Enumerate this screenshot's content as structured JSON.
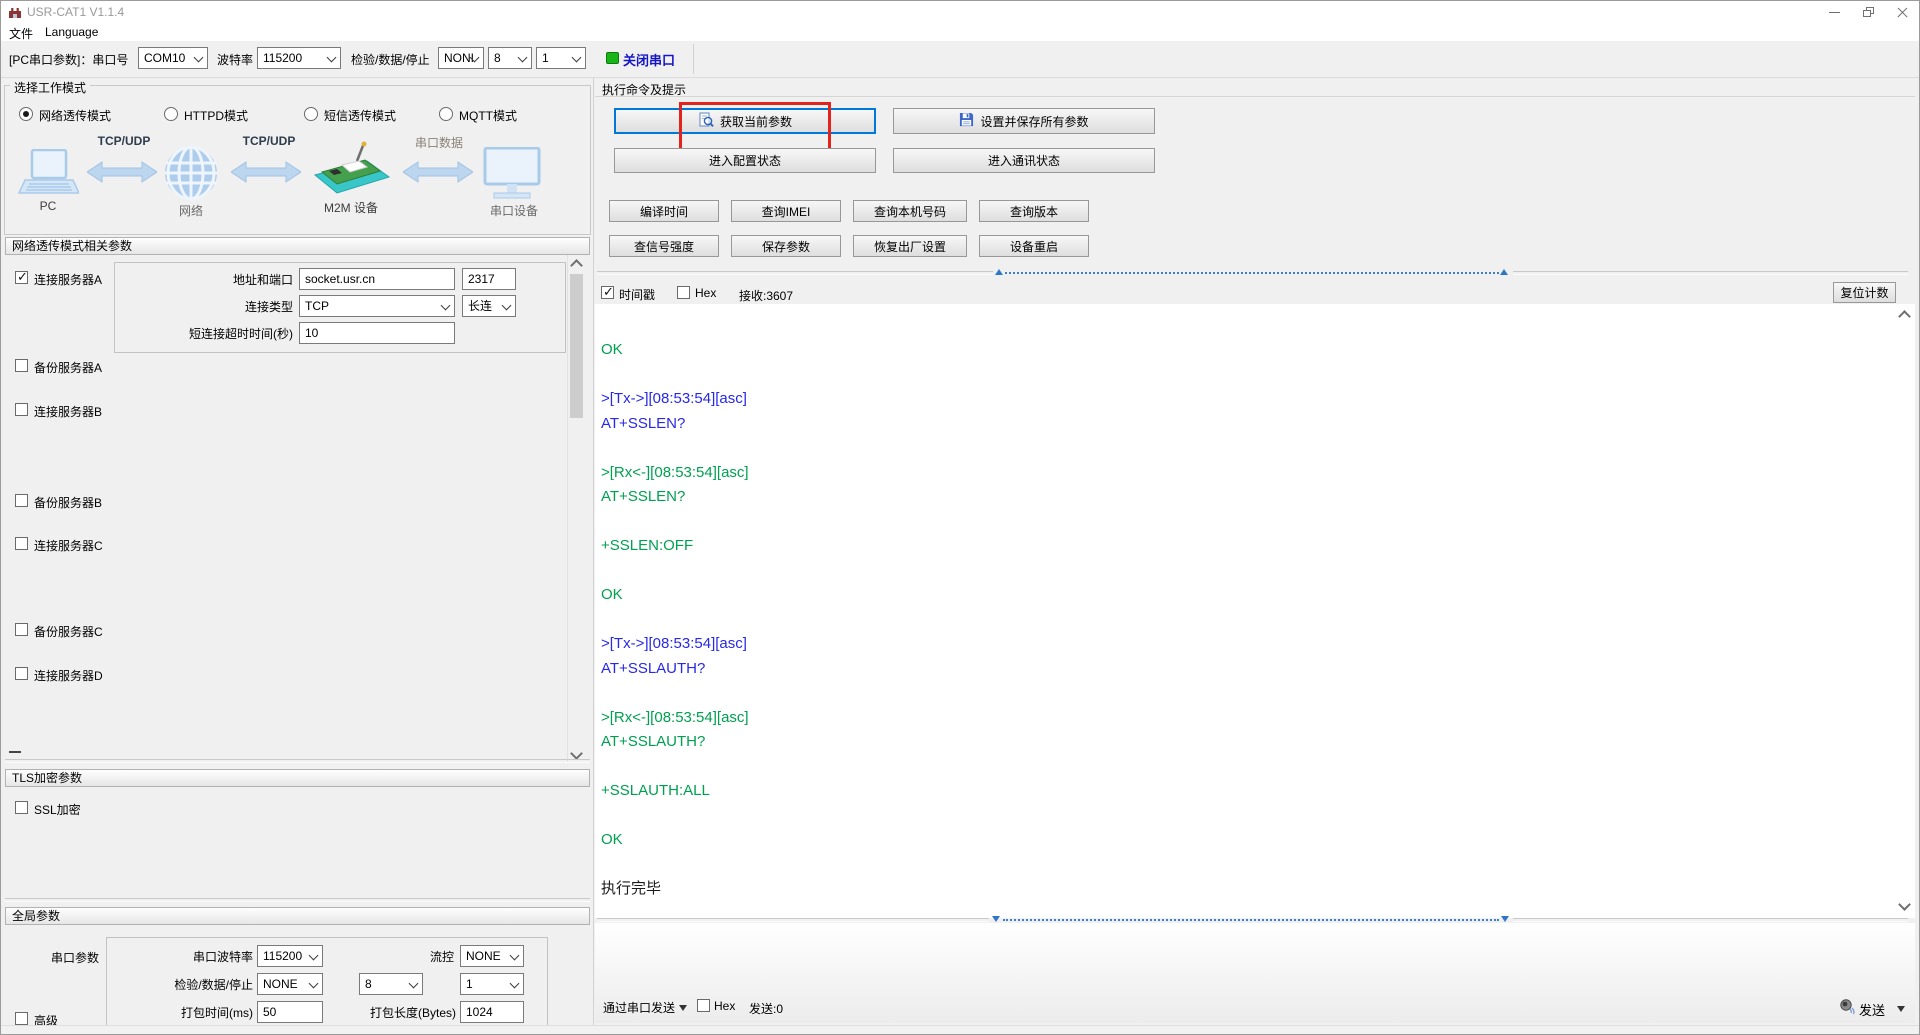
{
  "window": {
    "title": "USR-CAT1 V1.1.4"
  },
  "menu": {
    "file": "文件",
    "language": "Language"
  },
  "toolbar": {
    "pc_params_label": "[PC串口参数]：串口号",
    "com_port": "COM10",
    "baud_label": "波特率",
    "baud": "115200",
    "parity_label": "检验/数据/停止",
    "parity": "NONI",
    "data_bits": "8",
    "stop_bits": "1",
    "close_serial": "关闭串口"
  },
  "work_mode": {
    "title": "选择工作模式",
    "options": [
      {
        "label": "网络透传模式",
        "selected": true
      },
      {
        "label": "HTTPD模式",
        "selected": false
      },
      {
        "label": "短信透传模式",
        "selected": false
      },
      {
        "label": "MQTT模式",
        "selected": false
      }
    ],
    "diagram": {
      "link1": "TCP/UDP",
      "link2": "TCP/UDP",
      "link3": "串口数据",
      "node1": "PC",
      "node2": "网络",
      "node3": "M2M 设备",
      "node4": "串口设备"
    }
  },
  "net_params": {
    "title": "网络透传模式相关参数",
    "server_a_label": "连接服务器A",
    "addr_label": "地址和端口",
    "addr": "socket.usr.cn",
    "port": "2317",
    "conn_type_label": "连接类型",
    "conn_type": "TCP",
    "conn_mode": "长连",
    "timeout_label": "短连接超时时间(秒)",
    "timeout": "10",
    "backup_a": "备份服务器A",
    "server_b": "连接服务器B",
    "backup_b": "备份服务器B",
    "server_c": "连接服务器C",
    "backup_c": "备份服务器C",
    "server_d": "连接服务器D"
  },
  "tls": {
    "title": "TLS加密参数",
    "ssl_label": "SSL加密"
  },
  "global_params": {
    "title": "全局参数",
    "serial_group_label": "串口参数",
    "baud_label": "串口波特率",
    "baud": "115200",
    "flow_label": "流控",
    "flow": "NONE",
    "parity_label": "检验/数据/停止",
    "parity": "NONE",
    "data_bits": "8",
    "stop_bits": "1",
    "pack_time_label": "打包时间(ms)",
    "pack_time": "50",
    "pack_len_label": "打包长度(Bytes)",
    "pack_len": "1024",
    "advanced_label": "高级"
  },
  "command_panel": {
    "title": "执行命令及提示",
    "get_params": "获取当前参数",
    "set_save_params": "设置并保存所有参数",
    "enter_config": "进入配置状态",
    "enter_comm": "进入通讯状态",
    "small_buttons": [
      "编译时间",
      "查询IMEI",
      "查询本机号码",
      "查询版本",
      "查信号强度",
      "保存参数",
      "恢复出厂设置",
      "设备重启"
    ],
    "highlight_color": "#E3241C"
  },
  "log": {
    "timestamp_label": "时间戳",
    "hex_label": "Hex",
    "recv_count": "接收:3607",
    "reset_count": "复位计数",
    "colors": {
      "green": "#00A050",
      "blue": "#2828E8",
      "black": "#1A1A1A"
    },
    "lines": [
      {
        "text": "OK",
        "color": "green"
      },
      {
        "text": "",
        "color": "black"
      },
      {
        "text": ">[Tx->][08:53:54][asc]",
        "color": "blue"
      },
      {
        "text": "AT+SSLEN?",
        "color": "blue"
      },
      {
        "text": "",
        "color": "black"
      },
      {
        "text": ">[Rx<-][08:53:54][asc]",
        "color": "green"
      },
      {
        "text": "AT+SSLEN?",
        "color": "green"
      },
      {
        "text": "",
        "color": "black"
      },
      {
        "text": "+SSLEN:OFF",
        "color": "green"
      },
      {
        "text": "",
        "color": "black"
      },
      {
        "text": "OK",
        "color": "green"
      },
      {
        "text": "",
        "color": "black"
      },
      {
        "text": ">[Tx->][08:53:54][asc]",
        "color": "blue"
      },
      {
        "text": "AT+SSLAUTH?",
        "color": "blue"
      },
      {
        "text": "",
        "color": "black"
      },
      {
        "text": ">[Rx<-][08:53:54][asc]",
        "color": "green"
      },
      {
        "text": "AT+SSLAUTH?",
        "color": "green"
      },
      {
        "text": "",
        "color": "black"
      },
      {
        "text": "+SSLAUTH:ALL",
        "color": "green"
      },
      {
        "text": "",
        "color": "black"
      },
      {
        "text": "OK",
        "color": "green"
      },
      {
        "text": "",
        "color": "black"
      },
      {
        "text": "执行完毕",
        "color": "black"
      }
    ]
  },
  "send": {
    "via_serial": "通过串口发送",
    "hex_label": "Hex",
    "sent_count": "发送:0",
    "send_label": "发送"
  },
  "colors": {
    "accent_focus": "#0078D7",
    "led_green": "#18B418",
    "close_serial_text": "#1414C8",
    "annotation_red": "#E3241C"
  }
}
